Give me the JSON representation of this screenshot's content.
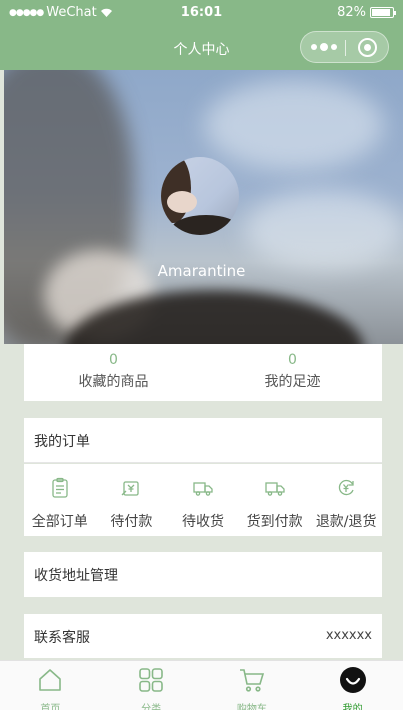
{
  "status": {
    "carrier": "WeChat",
    "time": "16:01",
    "battery": "82%"
  },
  "nav": {
    "title": "个人中心"
  },
  "profile": {
    "username": "Amarantine"
  },
  "stats": [
    {
      "value": "0",
      "label": "收藏的商品"
    },
    {
      "value": "0",
      "label": "我的足迹"
    }
  ],
  "orders": {
    "title": "我的订单",
    "items": [
      {
        "label": "全部订单",
        "icon": "clipboard-icon"
      },
      {
        "label": "待付款",
        "icon": "payment-icon"
      },
      {
        "label": "待收货",
        "icon": "truck-icon"
      },
      {
        "label": "货到付款",
        "icon": "truck-icon"
      },
      {
        "label": "退款/退货",
        "icon": "refund-icon"
      }
    ]
  },
  "address": {
    "label": "收货地址管理"
  },
  "service": {
    "label": "联系客服",
    "value": "xxxxxx"
  },
  "tabs": [
    {
      "label": "首页",
      "icon": "home-icon"
    },
    {
      "label": "分类",
      "icon": "grid-icon"
    },
    {
      "label": "购物车",
      "icon": "cart-icon"
    },
    {
      "label": "我的",
      "icon": "profile-icon"
    }
  ],
  "colors": {
    "accent": "#88b888",
    "active_tab": "#2e9a2e",
    "background": "#dfe5db"
  }
}
